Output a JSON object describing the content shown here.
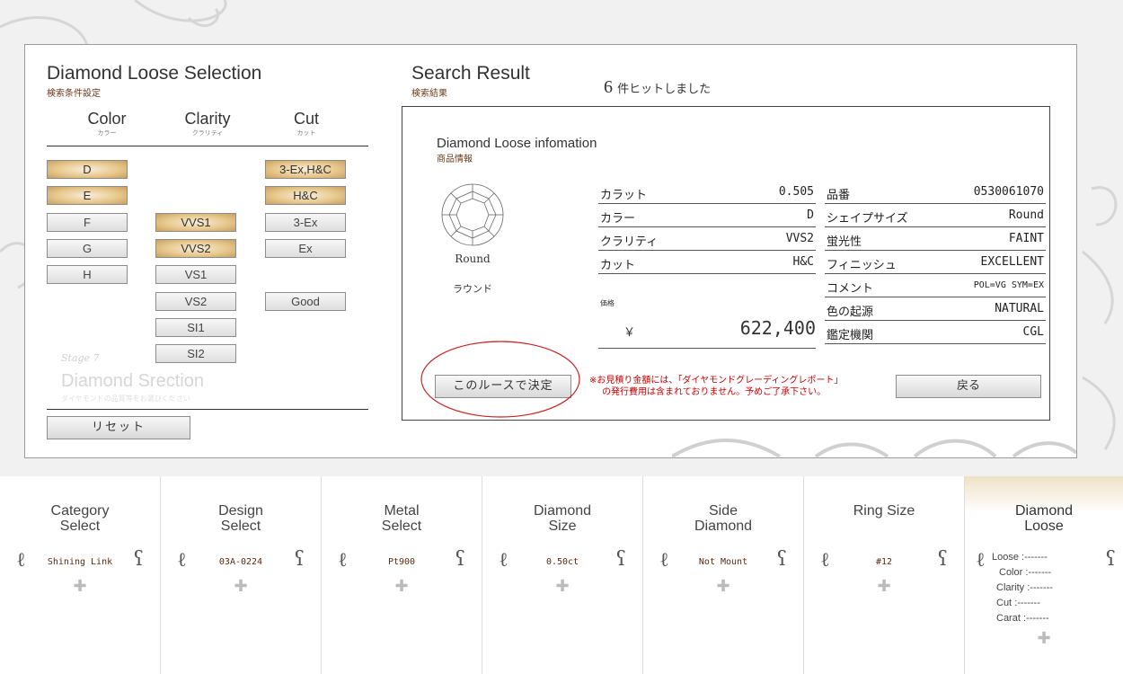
{
  "left_section": {
    "title": "Diamond Loose Selection",
    "subtitle": "検索条件設定"
  },
  "columns": [
    {
      "en": "Color",
      "jp": "カラー"
    },
    {
      "en": "Clarity",
      "jp": "クラリティ"
    },
    {
      "en": "Cut",
      "jp": "カット"
    }
  ],
  "color_options": [
    {
      "label": "D",
      "selected": true
    },
    {
      "label": "E",
      "selected": true
    },
    {
      "label": "F",
      "selected": false
    },
    {
      "label": "G",
      "selected": false
    },
    {
      "label": "H",
      "selected": false
    }
  ],
  "clarity_options": [
    {
      "label": "VVS1",
      "selected": true
    },
    {
      "label": "VVS2",
      "selected": true
    },
    {
      "label": "VS1",
      "selected": false
    },
    {
      "label": "VS2",
      "selected": false
    },
    {
      "label": "SI1",
      "selected": false
    },
    {
      "label": "SI2",
      "selected": false
    }
  ],
  "cut_options": [
    {
      "label": "3-Ex,H&C",
      "selected": true
    },
    {
      "label": "H&C",
      "selected": true
    },
    {
      "label": "3-Ex",
      "selected": false
    },
    {
      "label": "Ex",
      "selected": false
    },
    {
      "label": "Good",
      "selected": false
    }
  ],
  "watermark": {
    "stage": "Stage 7",
    "title": "Diamond Srection",
    "sub": "ダイヤモンドの品質等をお選びください"
  },
  "reset_label": "リセット",
  "search_result": {
    "title": "Search Result",
    "subtitle": "検索結果",
    "count": "6",
    "count_text": "件ヒットしました"
  },
  "info": {
    "title": "Diamond Loose infomation",
    "subtitle": "商品情報",
    "shape_en": "Round",
    "shape_jp": "ラウンド",
    "specs_left": [
      {
        "key": "カラット",
        "value": "0.505"
      },
      {
        "key": "カラー",
        "value": "D"
      },
      {
        "key": "クラリティ",
        "value": "VVS2"
      },
      {
        "key": "カット",
        "value": "H&C"
      }
    ],
    "price_label": "価格",
    "currency": "￥",
    "price": "622,400",
    "specs_right": [
      {
        "key": "品番",
        "value": "0530061070"
      },
      {
        "key": "シェイプサイズ",
        "value": "Round"
      },
      {
        "key": "蛍光性",
        "value": "FAINT"
      },
      {
        "key": "フィニッシュ",
        "value": "EXCELLENT"
      },
      {
        "key": "コメント",
        "value": "POL=VG SYM=EX"
      },
      {
        "key": "色の起源",
        "value": "NATURAL"
      },
      {
        "key": "鑑定機関",
        "value": "CGL"
      }
    ],
    "decide_label": "このルースで決定",
    "note_line1": "※お見積り金額には、「ダイヤモンドグレーディングレポート」",
    "note_line2": "の発行費用は含まれておりません。予めご了承下さい。",
    "back_label": "戻る"
  },
  "colors": {
    "accent_gold": "#d8b27a",
    "note_red": "#cc0000",
    "highlight_circle": "#cc2222"
  },
  "nav_steps": [
    {
      "title1": "Category",
      "title2": "Select",
      "value": "Shining Link"
    },
    {
      "title1": "Design",
      "title2": "Select",
      "value": "03A-0224"
    },
    {
      "title1": "Metal",
      "title2": "Select",
      "value": "Pt900"
    },
    {
      "title1": "Diamond",
      "title2": "Size",
      "value": "0.50ct"
    },
    {
      "title1": "Side",
      "title2": "Diamond",
      "value": "Not Mount"
    },
    {
      "title1": "Ring Size",
      "title2": "",
      "value": "#12"
    }
  ],
  "nav_active": {
    "title1": "Diamond",
    "title2": "Loose",
    "lines": [
      {
        "label": "Loose",
        "value": ":-------"
      },
      {
        "label": "Color",
        "value": ":-------"
      },
      {
        "label": "Clarity",
        "value": ":-------"
      },
      {
        "label": "Cut",
        "value": ":-------"
      },
      {
        "label": "Carat",
        "value": ":-------"
      }
    ]
  }
}
